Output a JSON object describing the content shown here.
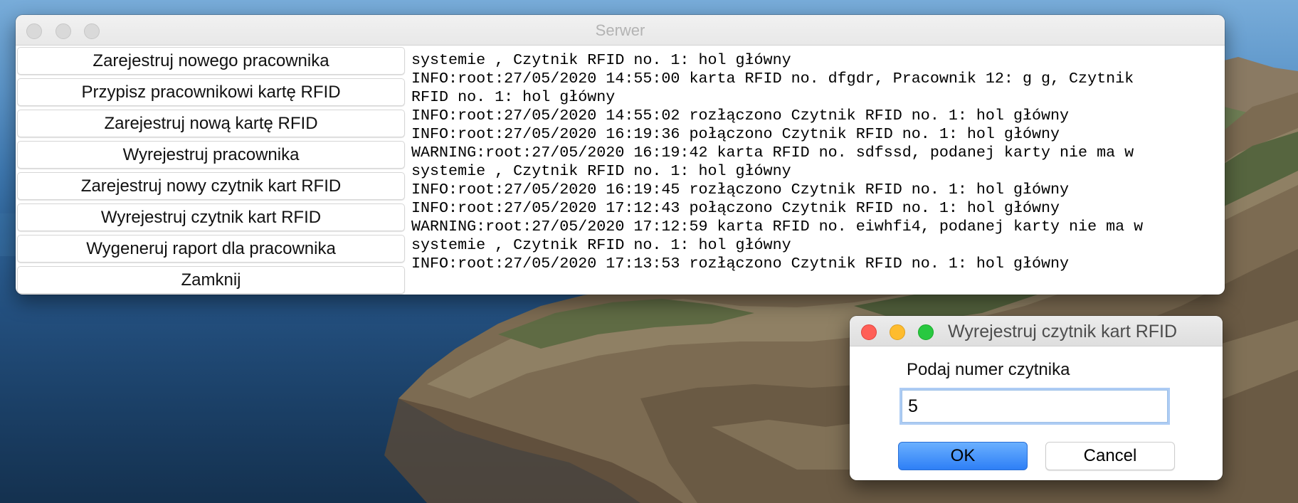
{
  "colors": {
    "ok_button": "#2e7ff6",
    "close_red": "#ff5f57",
    "minimize_yellow": "#febc2e",
    "zoom_green": "#28c840"
  },
  "main_window": {
    "title": "Serwer",
    "buttons": [
      "Zarejestruj nowego pracownika",
      "Przypisz pracownikowi kartę RFID",
      "Zarejestruj nową kartę RFID",
      "Wyrejestruj pracownika",
      "Zarejestruj nowy czytnik kart RFID",
      "Wyrejestruj czytnik kart RFID",
      "Wygeneruj raport dla pracownika",
      "Zamknij"
    ],
    "log_lines": [
      "systemie , Czytnik RFID no. 1: hol główny",
      "INFO:root:27/05/2020 14:55:00 karta RFID no. dfgdr, Pracownik 12: g g, Czytnik",
      "RFID no. 1: hol główny",
      "INFO:root:27/05/2020 14:55:02 rozłączono Czytnik RFID no. 1: hol główny",
      "INFO:root:27/05/2020 16:19:36 połączono Czytnik RFID no. 1: hol główny",
      "WARNING:root:27/05/2020 16:19:42 karta RFID no. sdfssd, podanej karty nie ma w",
      "systemie , Czytnik RFID no. 1: hol główny",
      "INFO:root:27/05/2020 16:19:45 rozłączono Czytnik RFID no. 1: hol główny",
      "INFO:root:27/05/2020 17:12:43 połączono Czytnik RFID no. 1: hol główny",
      "WARNING:root:27/05/2020 17:12:59 karta RFID no. eiwhfi4, podanej karty nie ma w",
      "systemie , Czytnik RFID no. 1: hol główny",
      "INFO:root:27/05/2020 17:13:53 rozłączono Czytnik RFID no. 1: hol główny"
    ]
  },
  "dialog": {
    "title": "Wyrejestruj czytnik kart RFID",
    "prompt": "Podaj numer czytnika",
    "input_value": "5",
    "ok_label": "OK",
    "cancel_label": "Cancel"
  }
}
